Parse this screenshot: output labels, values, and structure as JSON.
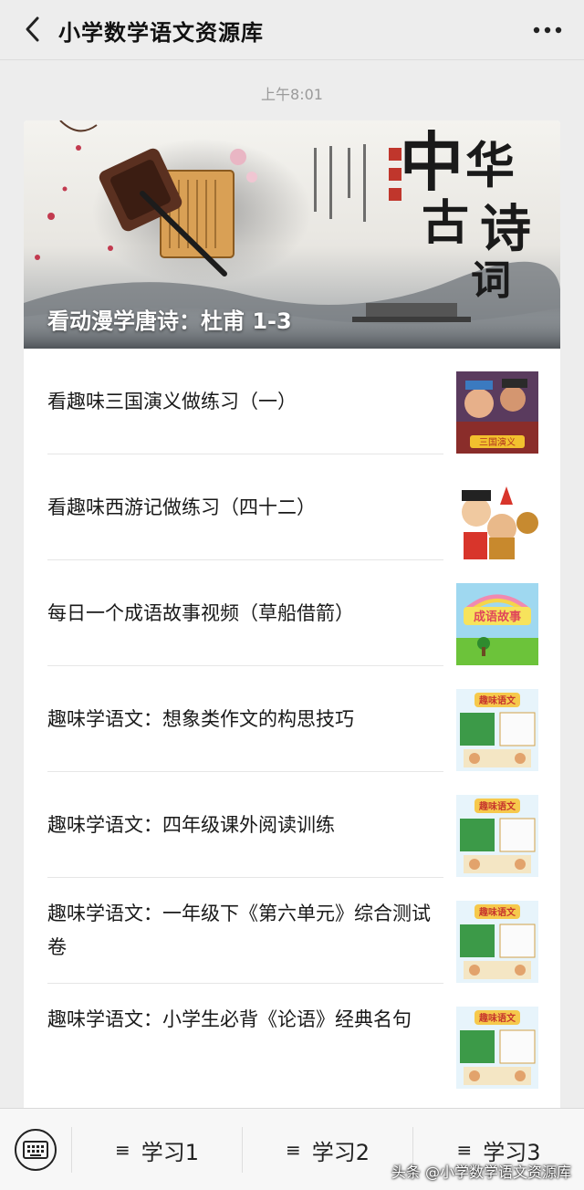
{
  "header": {
    "title": "小学数学语文资源库",
    "back_icon": "chevron-left-icon",
    "more_icon": "more-dots-icon"
  },
  "timestamp": "上午8:01",
  "banner": {
    "caption": "看动漫学唐诗：杜甫 1-3",
    "calligraphy": "中华古诗词"
  },
  "articles": [
    {
      "title": "看趣味三国演义做练习（一）",
      "thumb": "sanguo-cartoon"
    },
    {
      "title": "看趣味西游记做练习（四十二）",
      "thumb": "xiyouji-cartoon"
    },
    {
      "title": "每日一个成语故事视频（草船借箭）",
      "thumb": "idiom-story"
    },
    {
      "title": "趣味学语文：想象类作文的构思技巧",
      "thumb": "quwei-yuwen"
    },
    {
      "title": "趣味学语文：四年级课外阅读训练",
      "thumb": "quwei-yuwen"
    },
    {
      "title": "趣味学语文：一年级下《第六单元》综合测试卷",
      "thumb": "quwei-yuwen"
    },
    {
      "title": "趣味学语文：小学生必背《论语》经典名句",
      "thumb": "quwei-yuwen"
    }
  ],
  "bottom_menu": {
    "keyboard_icon": "keyboard-icon",
    "items": [
      "学习1",
      "学习2",
      "学习3"
    ]
  },
  "watermark": "头条 @小学数学语文资源库",
  "colors": {
    "background": "#ededed",
    "card": "#ffffff",
    "text": "#191919",
    "muted": "#9a9a9a"
  }
}
